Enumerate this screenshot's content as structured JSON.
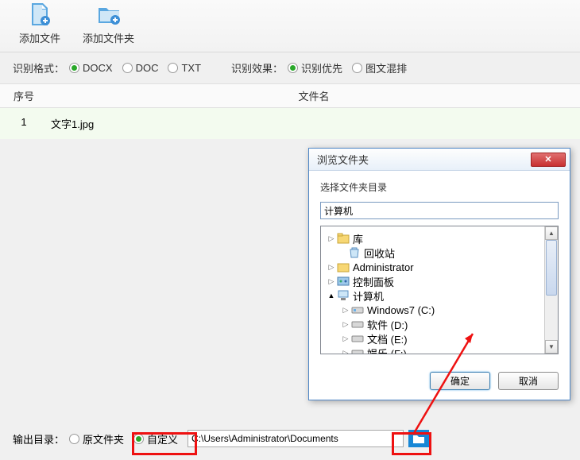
{
  "toolbar": {
    "add_file": "添加文件",
    "add_folder": "添加文件夹"
  },
  "options": {
    "format_label": "识别格式：",
    "fmt_docx": "DOCX",
    "fmt_doc": "DOC",
    "fmt_txt": "TXT",
    "effect_label": "识别效果：",
    "eff_priority": "识别优先",
    "eff_mixed": "图文混排"
  },
  "table": {
    "seq_header": "序号",
    "name_header": "文件名",
    "rows": [
      {
        "seq": "1",
        "name": "文字1.jpg"
      }
    ]
  },
  "dialog": {
    "title": "浏览文件夹",
    "subtitle": "选择文件夹目录",
    "combo_value": "计算机",
    "ok": "确定",
    "cancel": "取消",
    "tree": {
      "lib": "库",
      "recycle": "回收站",
      "admin": "Administrator",
      "ctrl": "控制面板",
      "computer": "计算机",
      "c": "Windows7 (C:)",
      "d": "软件 (D:)",
      "e": "文档 (E:)",
      "f": "娱乐 (F:)"
    }
  },
  "output": {
    "label": "输出目录：",
    "orig": "原文件夹",
    "custom": "自定义",
    "path": "C:\\Users\\Administrator\\Documents"
  }
}
